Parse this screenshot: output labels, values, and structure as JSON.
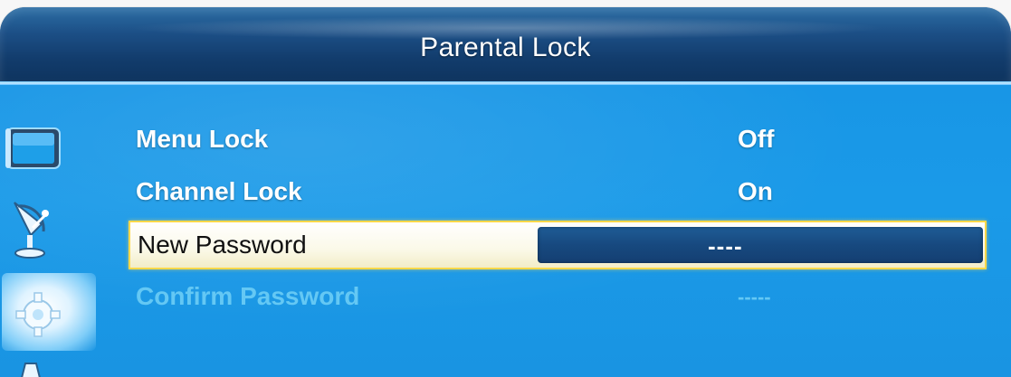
{
  "header": {
    "title": "Parental Lock"
  },
  "sidebar": {
    "icons": [
      "tv-icon",
      "satellite-icon",
      "setup-gear-icon",
      "more-icon"
    ]
  },
  "menu": {
    "items": [
      {
        "label": "Menu Lock",
        "value": "Off"
      },
      {
        "label": "Channel Lock",
        "value": "On"
      },
      {
        "label": "New Password",
        "value": "----"
      },
      {
        "label": "Confirm Password",
        "value": "-----"
      }
    ],
    "selected_index": 2
  },
  "colors": {
    "title_bar": "#123c6c",
    "panel": "#1896e6",
    "highlight": "#ffd84a",
    "disabled_text": "#64c8f4"
  }
}
